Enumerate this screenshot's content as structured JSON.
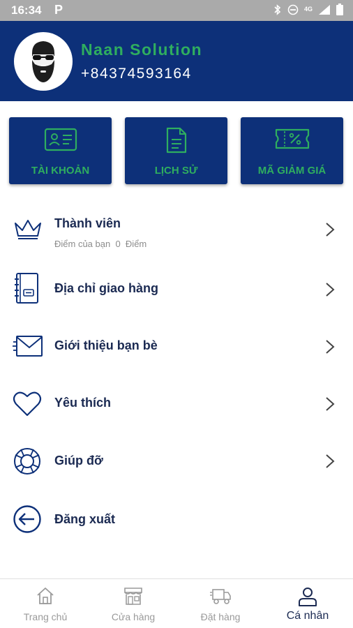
{
  "status_bar": {
    "time": "16:34",
    "app_icon": "P",
    "network": "4G",
    "icons": [
      "bluetooth-icon",
      "dnd-icon",
      "signal-icon",
      "battery-icon"
    ]
  },
  "profile": {
    "name": "Naan Solution",
    "phone": "+84374593164"
  },
  "quick_actions": [
    {
      "label": "TÀI KHOẢN",
      "icon": "id-card-icon"
    },
    {
      "label": "LỊCH SỬ",
      "icon": "document-icon"
    },
    {
      "label": "MÃ GIẢM GIÁ",
      "icon": "coupon-icon"
    }
  ],
  "menu": {
    "member": {
      "label": "Thành viên",
      "points_prefix": "Điểm của bạn",
      "points_value": "0",
      "points_unit": "Điểm",
      "icon": "crown-icon"
    },
    "address": {
      "label": "Địa chỉ giao hàng",
      "icon": "address-book-icon"
    },
    "invite": {
      "label": "Giới thiệu bạn bè",
      "icon": "envelope-icon"
    },
    "favorite": {
      "label": "Yêu thích",
      "icon": "heart-icon"
    },
    "help": {
      "label": "Giúp đỡ",
      "icon": "lifebuoy-icon"
    },
    "logout": {
      "label": "Đăng xuất",
      "icon": "logout-icon"
    }
  },
  "bottom_nav": [
    {
      "label": "Trang chủ",
      "icon": "home-icon",
      "active": false
    },
    {
      "label": "Cửa hàng",
      "icon": "store-icon",
      "active": false
    },
    {
      "label": "Đặt hàng",
      "icon": "delivery-truck-icon",
      "active": false
    },
    {
      "label": "Cá nhân",
      "icon": "user-icon",
      "active": true
    }
  ],
  "colors": {
    "brand_navy": "#0d3079",
    "accent_green": "#2fae5f",
    "text_dark": "#1b2a52",
    "status_bar": "#aaaaaa"
  }
}
